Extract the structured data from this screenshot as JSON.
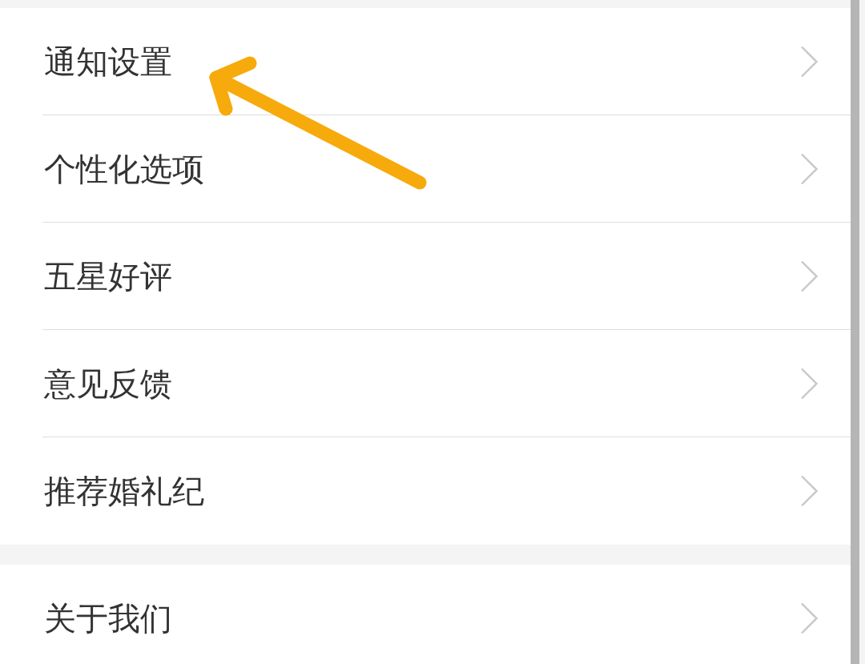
{
  "groups": [
    {
      "items": [
        {
          "label": "通知设置"
        },
        {
          "label": "个性化选项"
        },
        {
          "label": "五星好评"
        },
        {
          "label": "意见反馈"
        },
        {
          "label": "推荐婚礼纪"
        }
      ]
    },
    {
      "items": [
        {
          "label": "关于我们"
        }
      ]
    }
  ]
}
